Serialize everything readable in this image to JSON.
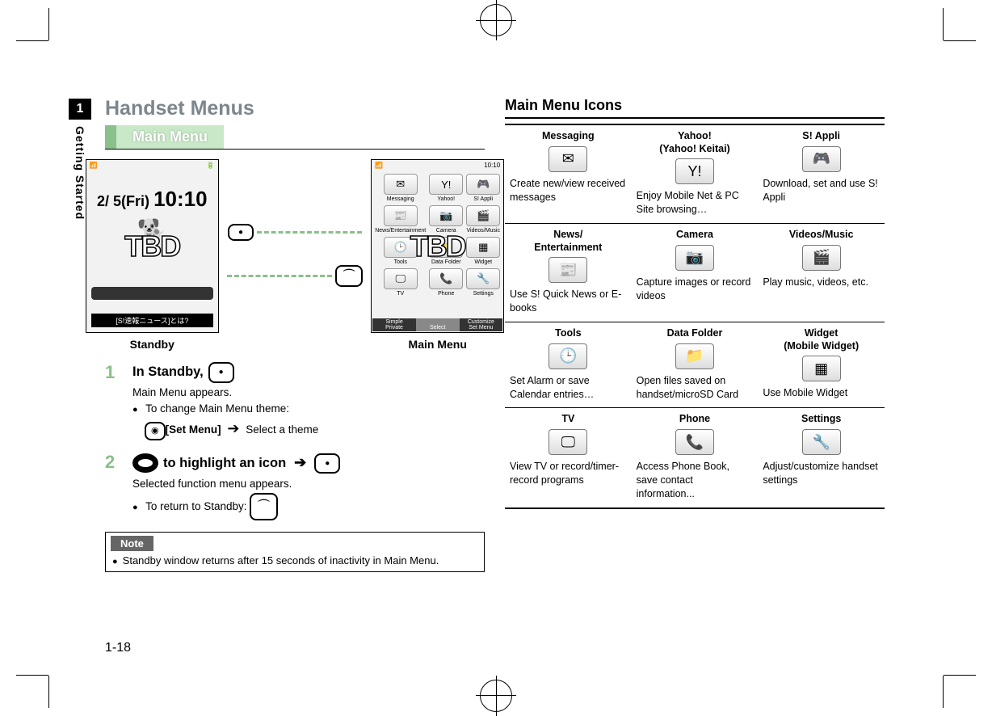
{
  "chapter": {
    "num": "1",
    "label": "Getting Started"
  },
  "title": "Handset Menus",
  "section_main_menu": "Main Menu",
  "phones": {
    "standby_caption": "Standby",
    "menu_caption": "Main Menu",
    "tbd": "TBD",
    "clock_date": "2/ 5(Fri)",
    "clock_time": "10:10",
    "menu_time": "10:10",
    "prompt": "[S!速報ニュース]とは?",
    "menu_cells": [
      {
        "label": "Messaging",
        "glyph": "✉"
      },
      {
        "label": "Yahoo!",
        "glyph": "Y!"
      },
      {
        "label": "S! Appli",
        "glyph": "🎮"
      },
      {
        "label": "News/Entertainment",
        "glyph": "📰"
      },
      {
        "label": "Camera",
        "glyph": "📷"
      },
      {
        "label": "Videos/Music",
        "glyph": "🎬"
      },
      {
        "label": "Tools",
        "glyph": "🕒"
      },
      {
        "label": "Data Folder",
        "glyph": "📁"
      },
      {
        "label": "Widget",
        "glyph": "▦"
      },
      {
        "label": "TV",
        "glyph": "🖵"
      },
      {
        "label": "Phone",
        "glyph": "📞"
      },
      {
        "label": "Settings",
        "glyph": "🔧"
      }
    ],
    "softkeys": {
      "left_top": "Simple",
      "left_bot": "Private",
      "center": "Select",
      "right_top": "Customize",
      "right_bot": "Set Menu"
    }
  },
  "steps": {
    "s1_head_prefix": "In Standby,",
    "s1_line1": "Main Menu appears.",
    "s1_b1": "To change Main Menu theme:",
    "s1_b1_key": "[Set Menu]",
    "s1_b1_tail": "Select a theme",
    "s2_head_mid": " to highlight an icon ",
    "s2_line1": "Selected function menu appears.",
    "s2_b1": "To return to Standby: "
  },
  "note": {
    "label": "Note",
    "body": "Standby window returns after 15 seconds of inactivity in Main Menu."
  },
  "section_icons": "Main Menu Icons",
  "icons": [
    {
      "name": "Messaging",
      "desc": "Create new/view received messages",
      "glyph": "✉"
    },
    {
      "name": "Yahoo!\n(Yahoo! Keitai)",
      "desc": "Enjoy Mobile Net & PC Site browsing…",
      "glyph": "Y!"
    },
    {
      "name": "S! Appli",
      "desc": "Download, set and use S! Appli",
      "glyph": "🎮"
    },
    {
      "name": "News/\nEntertainment",
      "desc": "Use S! Quick News or E-books",
      "glyph": "📰"
    },
    {
      "name": "Camera",
      "desc": "Capture images or record videos",
      "glyph": "📷"
    },
    {
      "name": "Videos/Music",
      "desc": "Play music, videos, etc.",
      "glyph": "🎬"
    },
    {
      "name": "Tools",
      "desc": "Set Alarm or save Calendar entries…",
      "glyph": "🕒"
    },
    {
      "name": "Data Folder",
      "desc": "Open files saved on handset/microSD Card",
      "glyph": "📁"
    },
    {
      "name": "Widget\n(Mobile Widget)",
      "desc": "Use Mobile Widget",
      "glyph": "▦"
    },
    {
      "name": "TV",
      "desc": "View TV or record/timer-record programs",
      "glyph": "🖵"
    },
    {
      "name": "Phone",
      "desc": "Access Phone Book, save contact information...",
      "glyph": "📞"
    },
    {
      "name": "Settings",
      "desc": "Adjust/customize handset settings",
      "glyph": "🔧"
    }
  ],
  "pagenum": "1-18"
}
